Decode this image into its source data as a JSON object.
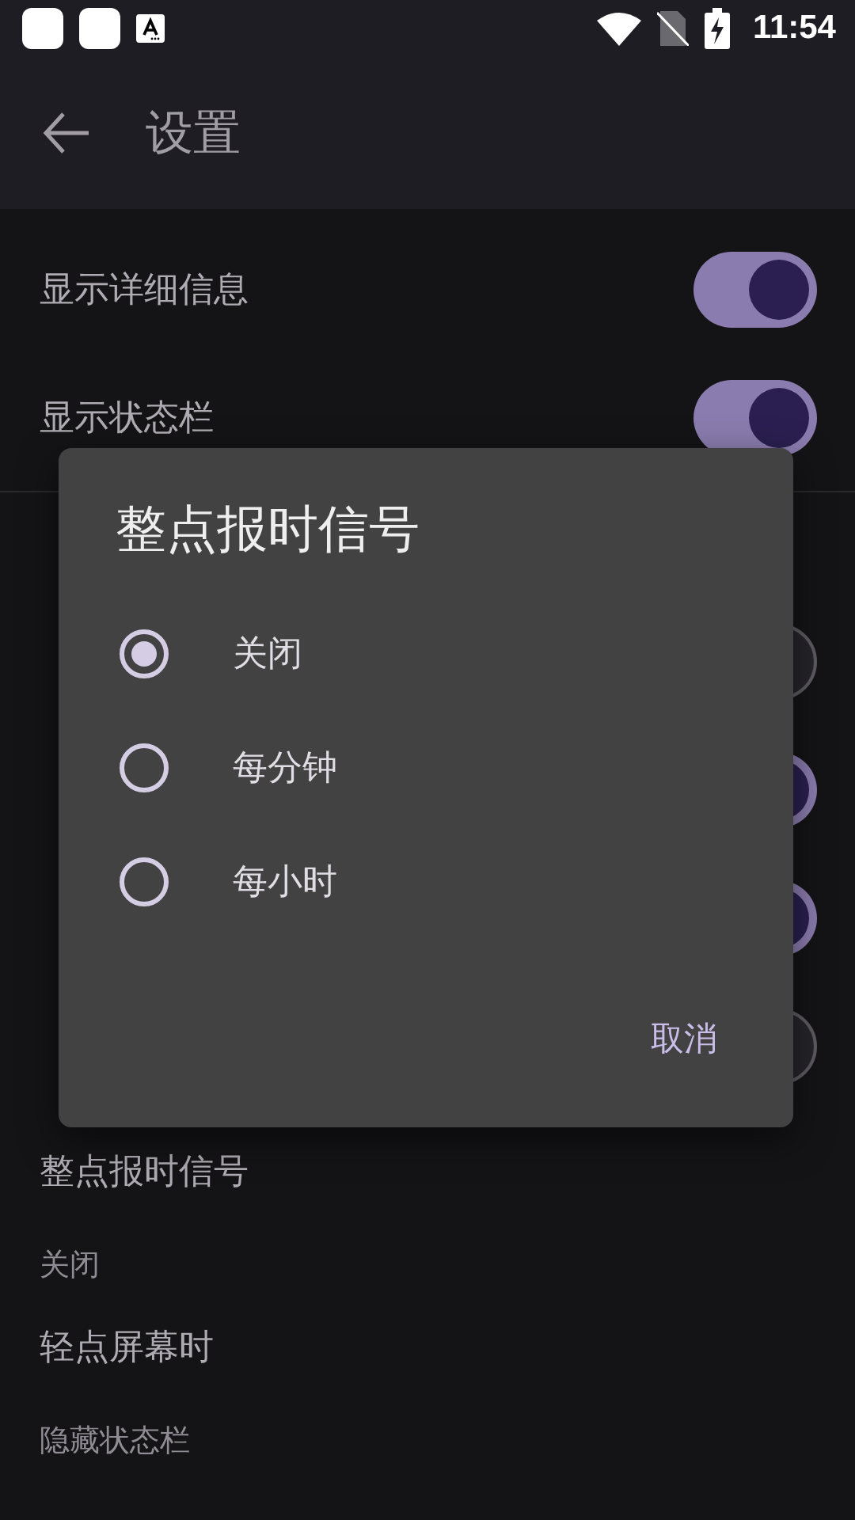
{
  "status_bar": {
    "time": "11:54",
    "notification_icons": [
      {
        "kind": "square"
      },
      {
        "kind": "square"
      },
      {
        "kind": "keyboard"
      }
    ]
  },
  "app_bar": {
    "title": "设置"
  },
  "settings": [
    {
      "kind": "switch",
      "label": "显示详细信息",
      "on": true
    },
    {
      "kind": "switch",
      "label": "显示状态栏",
      "on": true
    },
    {
      "kind": "header"
    },
    {
      "kind": "switch",
      "on": false
    },
    {
      "kind": "switch",
      "on": true
    },
    {
      "kind": "switch",
      "on": true
    },
    {
      "kind": "switch",
      "on": false
    },
    {
      "kind": "value",
      "label": "整点报时信号",
      "value": "关闭"
    },
    {
      "kind": "value",
      "label": "轻点屏幕时",
      "value": "隐藏状态栏"
    }
  ],
  "dialog": {
    "title": "整点报时信号",
    "options": [
      {
        "label": "关闭",
        "selected": true
      },
      {
        "label": "每分钟",
        "selected": false
      },
      {
        "label": "每小时",
        "selected": false
      }
    ],
    "buttons": [
      "取消"
    ]
  }
}
